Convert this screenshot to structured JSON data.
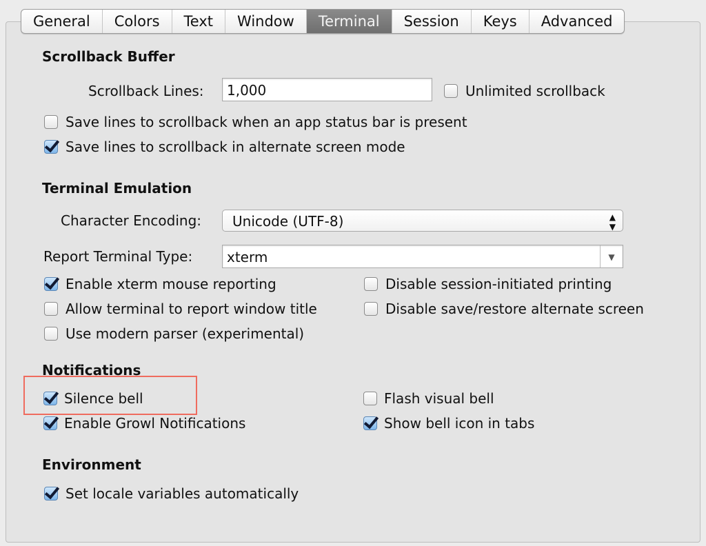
{
  "tabs": [
    {
      "label": "General"
    },
    {
      "label": "Colors"
    },
    {
      "label": "Text"
    },
    {
      "label": "Window"
    },
    {
      "label": "Terminal",
      "active": true
    },
    {
      "label": "Session"
    },
    {
      "label": "Keys"
    },
    {
      "label": "Advanced"
    }
  ],
  "scrollback": {
    "heading": "Scrollback Buffer",
    "lines_label": "Scrollback Lines:",
    "lines_value": "1,000",
    "unlimited": {
      "label": "Unlimited scrollback",
      "checked": false
    },
    "status_bar": {
      "label": "Save lines to scrollback when an app status bar is present",
      "checked": false
    },
    "alternate": {
      "label": "Save lines to scrollback in alternate screen mode",
      "checked": true
    }
  },
  "emulation": {
    "heading": "Terminal Emulation",
    "encoding_label": "Character Encoding:",
    "encoding_value": "Unicode (UTF-8)",
    "type_label": "Report Terminal Type:",
    "type_value": "xterm",
    "options": [
      {
        "label": "Enable xterm mouse reporting",
        "checked": true
      },
      {
        "label": "Disable session-initiated printing",
        "checked": false
      },
      {
        "label": "Allow terminal to report window title",
        "checked": false
      },
      {
        "label": "Disable save/restore alternate screen",
        "checked": false
      },
      {
        "label": "Use modern parser (experimental)",
        "checked": false
      }
    ]
  },
  "notifications": {
    "heading": "Notifications",
    "options": [
      {
        "label": "Silence bell",
        "checked": true
      },
      {
        "label": "Flash visual bell",
        "checked": false
      },
      {
        "label": "Enable Growl Notifications",
        "checked": true
      },
      {
        "label": "Show bell icon in tabs",
        "checked": true
      }
    ]
  },
  "environment": {
    "heading": "Environment",
    "options": [
      {
        "label": "Set locale variables automatically",
        "checked": true
      }
    ]
  },
  "highlight_color": "#ef6b5e"
}
